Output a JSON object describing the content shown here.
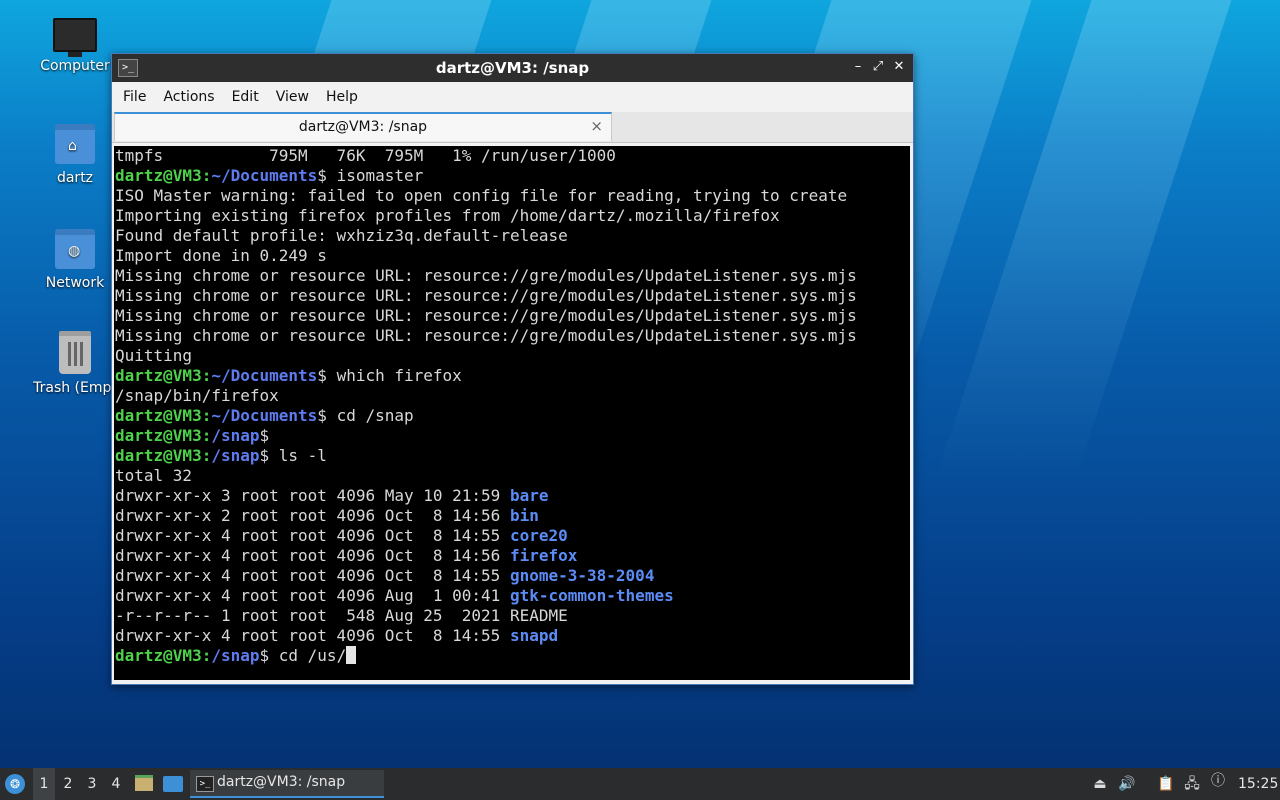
{
  "desktop": {
    "icons": [
      {
        "label": "Computer",
        "icon": "computer-icon"
      },
      {
        "label": "dartz",
        "icon": "home-folder-icon"
      },
      {
        "label": "Network",
        "icon": "network-folder-icon"
      },
      {
        "label": "Trash (Empt",
        "icon": "trash-icon"
      }
    ]
  },
  "window": {
    "title": "dartz@VM3: /snap",
    "icon": "terminal-icon",
    "controls": {
      "minimize": "–",
      "maximize": "⤢",
      "close": "✕"
    },
    "menu": [
      "File",
      "Actions",
      "Edit",
      "View",
      "Help"
    ],
    "tab": {
      "label": "dartz@VM3: /snap",
      "close": "×"
    }
  },
  "terminal": {
    "prompt_user": "dartz@VM3",
    "lines": [
      {
        "type": "out",
        "text": "tmpfs           795M   76K  795M   1% /run/user/1000"
      },
      {
        "type": "cmd",
        "path": "~/Documents",
        "cmd": " isomaster"
      },
      {
        "type": "out",
        "text": "ISO Master warning: failed to open config file for reading, trying to create"
      },
      {
        "type": "out",
        "text": "Importing existing firefox profiles from /home/dartz/.mozilla/firefox"
      },
      {
        "type": "out",
        "text": "Found default profile: wxhziz3q.default-release"
      },
      {
        "type": "out",
        "text": "Import done in 0.249 s"
      },
      {
        "type": "out",
        "text": "Missing chrome or resource URL: resource://gre/modules/UpdateListener.sys.mjs"
      },
      {
        "type": "out",
        "text": "Missing chrome or resource URL: resource://gre/modules/UpdateListener.sys.mjs"
      },
      {
        "type": "out",
        "text": "Missing chrome or resource URL: resource://gre/modules/UpdateListener.sys.mjs"
      },
      {
        "type": "out",
        "text": "Missing chrome or resource URL: resource://gre/modules/UpdateListener.sys.mjs"
      },
      {
        "type": "out",
        "text": "Quitting"
      },
      {
        "type": "cmd",
        "path": "~/Documents",
        "cmd": " which firefox"
      },
      {
        "type": "out",
        "text": "/snap/bin/firefox"
      },
      {
        "type": "cmd",
        "path": "~/Documents",
        "cmd": " cd /snap"
      },
      {
        "type": "cmd",
        "path": "/snap",
        "cmd": ""
      },
      {
        "type": "cmd",
        "path": "/snap",
        "cmd": " ls -l"
      },
      {
        "type": "out",
        "text": "total 32"
      },
      {
        "type": "ls",
        "meta": "drwxr-xr-x 3 root root 4096 May 10 21:59 ",
        "name": "bare",
        "dir": true
      },
      {
        "type": "ls",
        "meta": "drwxr-xr-x 2 root root 4096 Oct  8 14:56 ",
        "name": "bin",
        "dir": true
      },
      {
        "type": "ls",
        "meta": "drwxr-xr-x 4 root root 4096 Oct  8 14:55 ",
        "name": "core20",
        "dir": true
      },
      {
        "type": "ls",
        "meta": "drwxr-xr-x 4 root root 4096 Oct  8 14:56 ",
        "name": "firefox",
        "dir": true
      },
      {
        "type": "ls",
        "meta": "drwxr-xr-x 4 root root 4096 Oct  8 14:55 ",
        "name": "gnome-3-38-2004",
        "dir": true
      },
      {
        "type": "ls",
        "meta": "drwxr-xr-x 4 root root 4096 Aug  1 00:41 ",
        "name": "gtk-common-themes",
        "dir": true
      },
      {
        "type": "ls",
        "meta": "-r--r--r-- 1 root root  548 Aug 25  2021 ",
        "name": "README",
        "dir": false
      },
      {
        "type": "ls",
        "meta": "drwxr-xr-x 4 root root 4096 Oct  8 14:55 ",
        "name": "snapd",
        "dir": true
      },
      {
        "type": "cmd",
        "path": "/snap",
        "cmd": " cd /us/",
        "cursor": true
      }
    ]
  },
  "taskbar": {
    "start_icon": "start-menu-icon",
    "workspaces": [
      "1",
      "2",
      "3",
      "4"
    ],
    "active_workspace": "1",
    "launchers": [
      "file-manager-icon",
      "show-desktop-icon"
    ],
    "task": {
      "label": "dartz@VM3: /snap",
      "icon": "terminal-icon"
    },
    "tray": [
      "eject-icon",
      "volume-icon",
      "clipboard-icon",
      "network-icon",
      "update-notifier-icon"
    ],
    "clock": "15:25"
  },
  "colors": {
    "accent": "#3d8fd6",
    "prompt_green": "#4ed14b",
    "dir_blue": "#5d7cf0"
  }
}
